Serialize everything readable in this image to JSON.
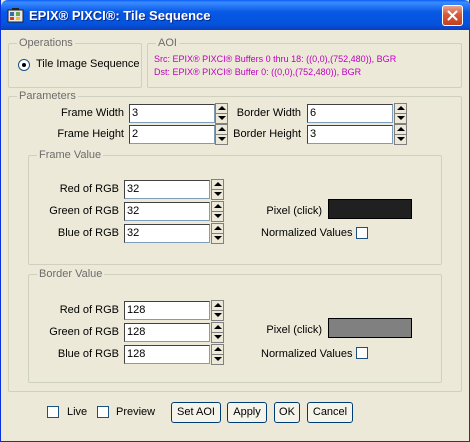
{
  "window": {
    "title": "EPIX® PIXCI®: Tile Sequence",
    "icon": "app-icon",
    "close_icon": "close-icon"
  },
  "operations": {
    "legend": "Operations",
    "option_label": "Tile Image Sequence",
    "selected": true
  },
  "aoi": {
    "legend": "AOI",
    "src": "Src: EPIX® PIXCI® Buffers 0 thru 18: ((0,0),(752,480)), BGR",
    "dst": "Dst: EPIX® PIXCI® Buffer 0: ((0,0),(752,480)), BGR",
    "text_color": "#c000c0"
  },
  "parameters": {
    "legend": "Parameters",
    "frame_width_label": "Frame Width",
    "frame_width_value": "3",
    "border_width_label": "Border Width",
    "border_width_value": "6",
    "frame_height_label": "Frame Height",
    "frame_height_value": "2",
    "border_height_label": "Border Height",
    "border_height_value": "3"
  },
  "frame_value": {
    "legend": "Frame Value",
    "red_label": "Red of RGB",
    "red_value": "32",
    "green_label": "Green of RGB",
    "green_value": "32",
    "blue_label": "Blue of RGB",
    "blue_value": "32",
    "pixel_label": "Pixel (click)",
    "swatch_color": "#202020",
    "normalized_label": "Normalized Values"
  },
  "border_value": {
    "legend": "Border Value",
    "red_label": "Red of RGB",
    "red_value": "128",
    "green_label": "Green of RGB",
    "green_value": "128",
    "blue_label": "Blue of RGB",
    "blue_value": "128",
    "pixel_label": "Pixel (click)",
    "swatch_color": "#808080",
    "normalized_label": "Normalized Values"
  },
  "bottom": {
    "live_label": "Live",
    "preview_label": "Preview",
    "set_aoi_label": "Set AOI",
    "apply_label": "Apply",
    "ok_label": "OK",
    "cancel_label": "Cancel"
  }
}
